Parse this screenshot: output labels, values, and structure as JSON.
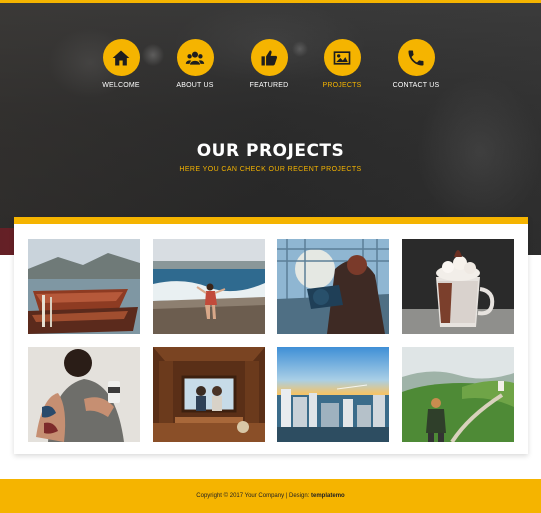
{
  "colors": {
    "accent": "#f5b400",
    "hero_overlay": "#2c2c2c",
    "footer_bg": "#f5b400"
  },
  "nav": {
    "items": [
      {
        "label": "WELCOME",
        "icon": "home-icon",
        "active": false
      },
      {
        "label": "ABOUT US",
        "icon": "users-icon",
        "active": false
      },
      {
        "label": "FEATURED",
        "icon": "thumbs-up-icon",
        "active": false
      },
      {
        "label": "PROJECTS",
        "icon": "image-icon",
        "active": true
      },
      {
        "label": "CONTACT US",
        "icon": "phone-icon",
        "active": false
      }
    ]
  },
  "hero": {
    "title": "OUR PROJECTS",
    "subtitle": "HERE YOU CAN CHECK OUR RECENT PROJECTS"
  },
  "gallery": {
    "images": [
      {
        "name": "boats-on-lake"
      },
      {
        "name": "woman-on-beach"
      },
      {
        "name": "binoculars-viewer"
      },
      {
        "name": "hot-chocolate-marshmallows"
      },
      {
        "name": "tattooed-woman-with-coffee"
      },
      {
        "name": "couple-in-boat-cabin"
      },
      {
        "name": "city-skyline-sunset"
      },
      {
        "name": "hiker-on-green-hills"
      }
    ]
  },
  "footer": {
    "copyright": "Copyright © 2017 Your Company | Design:",
    "brand": "templatemo"
  }
}
